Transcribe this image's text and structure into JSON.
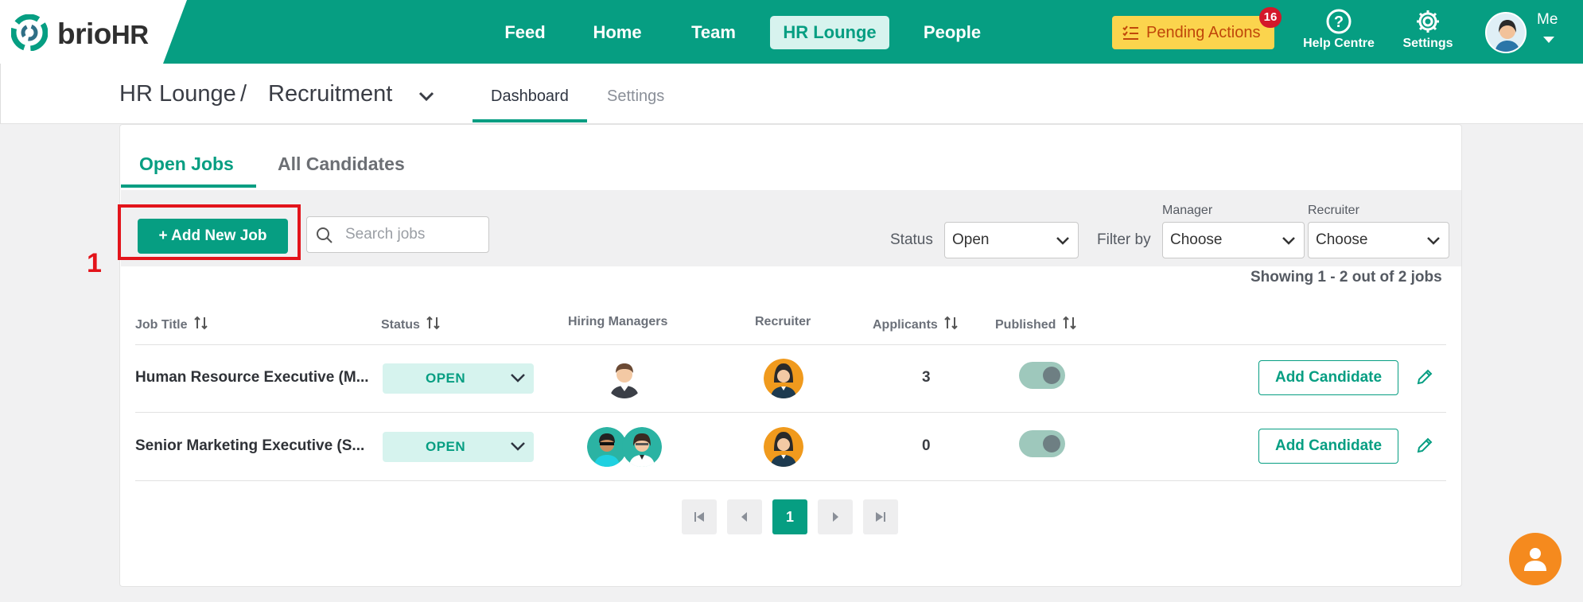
{
  "brand": {
    "name_main": "brio",
    "name_suffix": "HR"
  },
  "nav": {
    "items": [
      "Feed",
      "Home",
      "Team",
      "HR Lounge",
      "People"
    ],
    "active": "HR Lounge"
  },
  "pending_actions": {
    "label": "Pending Actions",
    "count": "16"
  },
  "help": {
    "label": "Help Centre",
    "icon": "question-circle-icon"
  },
  "settings": {
    "label": "Settings",
    "icon": "gear-icon"
  },
  "profile": {
    "label": "Me"
  },
  "breadcrumb": {
    "section": "HR Lounge",
    "separator": "/",
    "page": "Recruitment"
  },
  "subtabs": {
    "dashboard": "Dashboard",
    "settings": "Settings",
    "active": "Dashboard"
  },
  "tabs": {
    "open_jobs": "Open Jobs",
    "all_candidates": "All Candidates",
    "active": "Open Jobs"
  },
  "toolbar": {
    "add_job": "+ Add New Job",
    "search_placeholder": "Search jobs",
    "status_label": "Status",
    "status_value": "Open",
    "filter_by": "Filter by",
    "manager_label": "Manager",
    "manager_value": "Choose",
    "recruiter_label": "Recruiter",
    "recruiter_value": "Choose"
  },
  "annotation": {
    "step": "1"
  },
  "showing": "Showing 1 - 2 out of 2 jobs",
  "table": {
    "headers": {
      "job_title": "Job Title",
      "status": "Status",
      "hiring_managers": "Hiring Managers",
      "recruiter": "Recruiter",
      "applicants": "Applicants",
      "published": "Published"
    },
    "rows": [
      {
        "title": "Human Resource Executive (M...",
        "status": "OPEN",
        "applicants": "3",
        "published": true,
        "action": "Add Candidate"
      },
      {
        "title": "Senior Marketing Executive (S...",
        "status": "OPEN",
        "applicants": "0",
        "published": true,
        "action": "Add Candidate"
      }
    ]
  },
  "pagination": {
    "current": "1"
  },
  "colors": {
    "brand": "#069e82",
    "pending": "#fbd44d",
    "highlight": "#e3141b",
    "fab": "#f58a1e"
  }
}
